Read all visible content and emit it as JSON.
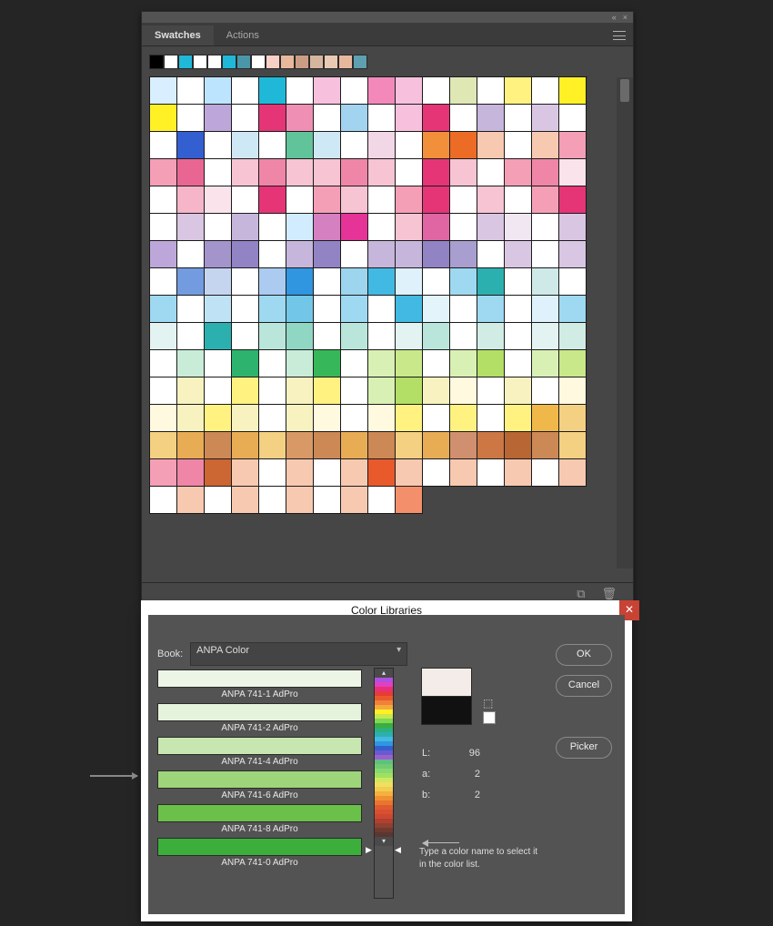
{
  "tabs": {
    "swatches": "Swatches",
    "actions": "Actions"
  },
  "quick_colors": [
    "#000000",
    "#ffffff",
    "#20b8d8",
    "#ffffff",
    "#ffffff",
    "#20b8d8",
    "#4a96a8",
    "#ffffff",
    "#f8d0c6",
    "#e8b89d",
    "#cc9d85",
    "#d6b69f",
    "#e8c9b3",
    "#e8b89d",
    "#5fa0b0"
  ],
  "grid_rows": [
    [
      "#d9efff",
      "#ffffff",
      "#bde4ff",
      "#ffffff",
      "#20b8d8",
      "#ffffff",
      "#f7c1dd",
      "#ffffff",
      "#f389ba",
      "#f7c1dd",
      "#ffffff",
      "#dfe7b4",
      "#ffffff",
      "#fff280",
      "#ffffff",
      "#fff125"
    ],
    [
      "#fff125",
      "#ffffff",
      "#bda6d9",
      "#ffffff",
      "#e53577",
      "#f08fb4",
      "#ffffff",
      "#a2d3ef",
      "#ffffff",
      "#f7c1dd",
      "#e53577",
      "#ffffff",
      "#c6b6db",
      "#ffffff",
      "#d9c6e3",
      "#ffffff"
    ],
    [
      "#ffffff",
      "#335fd1",
      "#ffffff",
      "#cfe8f5",
      "#ffffff",
      "#60c39a",
      "#cfe8f5",
      "#ffffff",
      "#f2d7e6",
      "#ffffff",
      "#f18f3a",
      "#ec6c26",
      "#f8c9b1",
      "#ffffff",
      "#f8c9b1",
      "#f59fb7"
    ],
    [
      "#f59fb7",
      "#e96693",
      "#ffffff",
      "#f6c4d3",
      "#ef86a8",
      "#f6c4d3",
      "#f6c4d3",
      "#ef86a8",
      "#f6c4d3",
      "#ffffff",
      "#e53577",
      "#f6c4d3",
      "#ffffff",
      "#f59fb7",
      "#ef86a8",
      "#fbe3ec"
    ],
    [
      "#ffffff",
      "#f6b5c8",
      "#fbe3ec",
      "#ffffff",
      "#e53577",
      "#ffffff",
      "#f59fb7",
      "#f6c4d3",
      "#ffffff",
      "#f59fb7",
      "#e53577",
      "#ffffff",
      "#f6c4d3",
      "#ffffff",
      "#f59fb7",
      "#e53577"
    ],
    [
      "#ffffff",
      "#d9c6e3",
      "#ffffff",
      "#c6b6db",
      "#ffffff",
      "#d1ecff",
      "#d580c0",
      "#e53398",
      "#ffffff",
      "#f6c4d3",
      "#e065a3",
      "#ffffff",
      "#d9c6e3",
      "#f1e7f3",
      "#ffffff",
      "#d9c6e3"
    ],
    [
      "#bda6d9",
      "#ffffff",
      "#a394cc",
      "#9183c4",
      "#ffffff",
      "#c6b6db",
      "#9183c4",
      "#ffffff",
      "#c6b6db",
      "#c6b6db",
      "#9183c4",
      "#a89ecf",
      "#ffffff",
      "#d9c6e3",
      "#ffffff",
      "#d9c6e3"
    ],
    [
      "#ffffff",
      "#739be0",
      "#c6d5ef",
      "#ffffff",
      "#abcbf0",
      "#3096e0",
      "#ffffff",
      "#9dd4ee",
      "#42b9e2",
      "#dff1fa",
      "#ffffff",
      "#9ed9f1",
      "#2cb0af",
      "#ffffff",
      "#cfe8e8",
      "#ffffff"
    ],
    [
      "#9ed9f1",
      "#ffffff",
      "#bfe3f5",
      "#ffffff",
      "#9ed9f1",
      "#72c7e8",
      "#ffffff",
      "#9ed9f1",
      "#ffffff",
      "#42b9e2",
      "#e3f4fb",
      "#ffffff",
      "#9ed9f1",
      "#ffffff",
      "#dff1fa",
      "#9ed9f1"
    ],
    [
      "#e3f3f1",
      "#ffffff",
      "#2cb0af",
      "#ffffff",
      "#b9e5db",
      "#8fd7c3",
      "#ffffff",
      "#b9e5db",
      "#ffffff",
      "#e3f3f1",
      "#b9e5db",
      "#ffffff",
      "#d1ece4",
      "#ffffff",
      "#e3f3f1",
      "#d1ece4"
    ],
    [
      "#ffffff",
      "#c8ecd8",
      "#ffffff",
      "#2db36e",
      "#ffffff",
      "#c8ecd8",
      "#36b85a",
      "#ffffff",
      "#d9f0b4",
      "#c9e88a",
      "#ffffff",
      "#d9f0b4",
      "#b3df66",
      "#ffffff",
      "#d9f0b4",
      "#c9e88a"
    ],
    [
      "#ffffff",
      "#f8f2c0",
      "#ffffff",
      "#fff280",
      "#ffffff",
      "#f8f2c0",
      "#fff280",
      "#ffffff",
      "#d9f0b4",
      "#b3df66",
      "#f8f2c0",
      "#fff9e0",
      "#ffffff",
      "#f8f2c0",
      "#ffffff",
      "#fff9e0"
    ],
    [
      "#fff9e0",
      "#f8f2c0",
      "#fff280",
      "#f8f2c0",
      "#ffffff",
      "#f8f2c0",
      "#fff9e0",
      "#ffffff",
      "#fff9e0",
      "#fff280",
      "#ffffff",
      "#fff280",
      "#ffffff",
      "#fff280",
      "#f0b84a",
      "#f4d083"
    ],
    [
      "#f4d083",
      "#e8ac55",
      "#cc8855",
      "#e8ac55",
      "#f4d083",
      "#d89966",
      "#cc8855",
      "#e8ac55",
      "#cc8855",
      "#f4d083",
      "#e8ac55",
      "#d09070",
      "#cc7744",
      "#b86633",
      "#cc8855",
      "#f4d083"
    ],
    [
      "#f59fb7",
      "#ef86a8",
      "#cc6633",
      "#f8c9b1",
      "#ffffff",
      "#f8c9b1",
      "#ffffff",
      "#f8c9b1",
      "#e85a2b",
      "#f8c9b1",
      "#ffffff",
      "#f8c9b1",
      "#ffffff",
      "#f8c9b1",
      "#ffffff",
      "#f8c9b1"
    ],
    [
      "#ffffff",
      "#f8c9b1",
      "#ffffff",
      "#f8c9b1",
      "#ffffff",
      "#f8c9b1",
      "#ffffff",
      "#f8c9b1",
      "#ffffff",
      "#f48f6b",
      "",
      "",
      "",
      "",
      "",
      ""
    ]
  ],
  "dialog": {
    "title": "Color Libraries",
    "book_label": "Book:",
    "book_value": "ANPA Color",
    "ok": "OK",
    "cancel": "Cancel",
    "picker": "Picker",
    "list": [
      {
        "color": "#edf6e6",
        "label": "ANPA 741-1 AdPro"
      },
      {
        "color": "#e6f3dc",
        "label": "ANPA 741-2 AdPro"
      },
      {
        "color": "#c8e6b0",
        "label": "ANPA 741-4 AdPro"
      },
      {
        "color": "#9ed57a",
        "label": "ANPA 741-6 AdPro"
      },
      {
        "color": "#6bc04a",
        "label": "ANPA 741-8 AdPro"
      },
      {
        "color": "#3cae3c",
        "label": "ANPA 741-0 AdPro"
      }
    ],
    "preview_top": "#f4ece9",
    "preview_bottom": "#111111",
    "L_label": "L:",
    "a_label": "a:",
    "b_label": "b:",
    "L": "96",
    "a": "2",
    "b": "2",
    "hint": "Type a color name to select it in the color list."
  },
  "strip": [
    "#b050e0",
    "#e040c0",
    "#e8307a",
    "#e83a3a",
    "#e85a2b",
    "#f0803a",
    "#f4aa3a",
    "#fff125",
    "#c9e84a",
    "#7ed957",
    "#3cae3c",
    "#2cb080",
    "#2cb0af",
    "#42b9e2",
    "#3096e0",
    "#335fd1",
    "#6a5acd",
    "#9a60d0",
    "#60c080",
    "#70cc70",
    "#88d870",
    "#a0e060",
    "#d0e860",
    "#f0e060",
    "#f4cc50",
    "#f4b040",
    "#f09030",
    "#e87530",
    "#e05a30",
    "#d85030",
    "#cc4830",
    "#b04030",
    "#904030",
    "#703a2e",
    "#5a3630"
  ]
}
